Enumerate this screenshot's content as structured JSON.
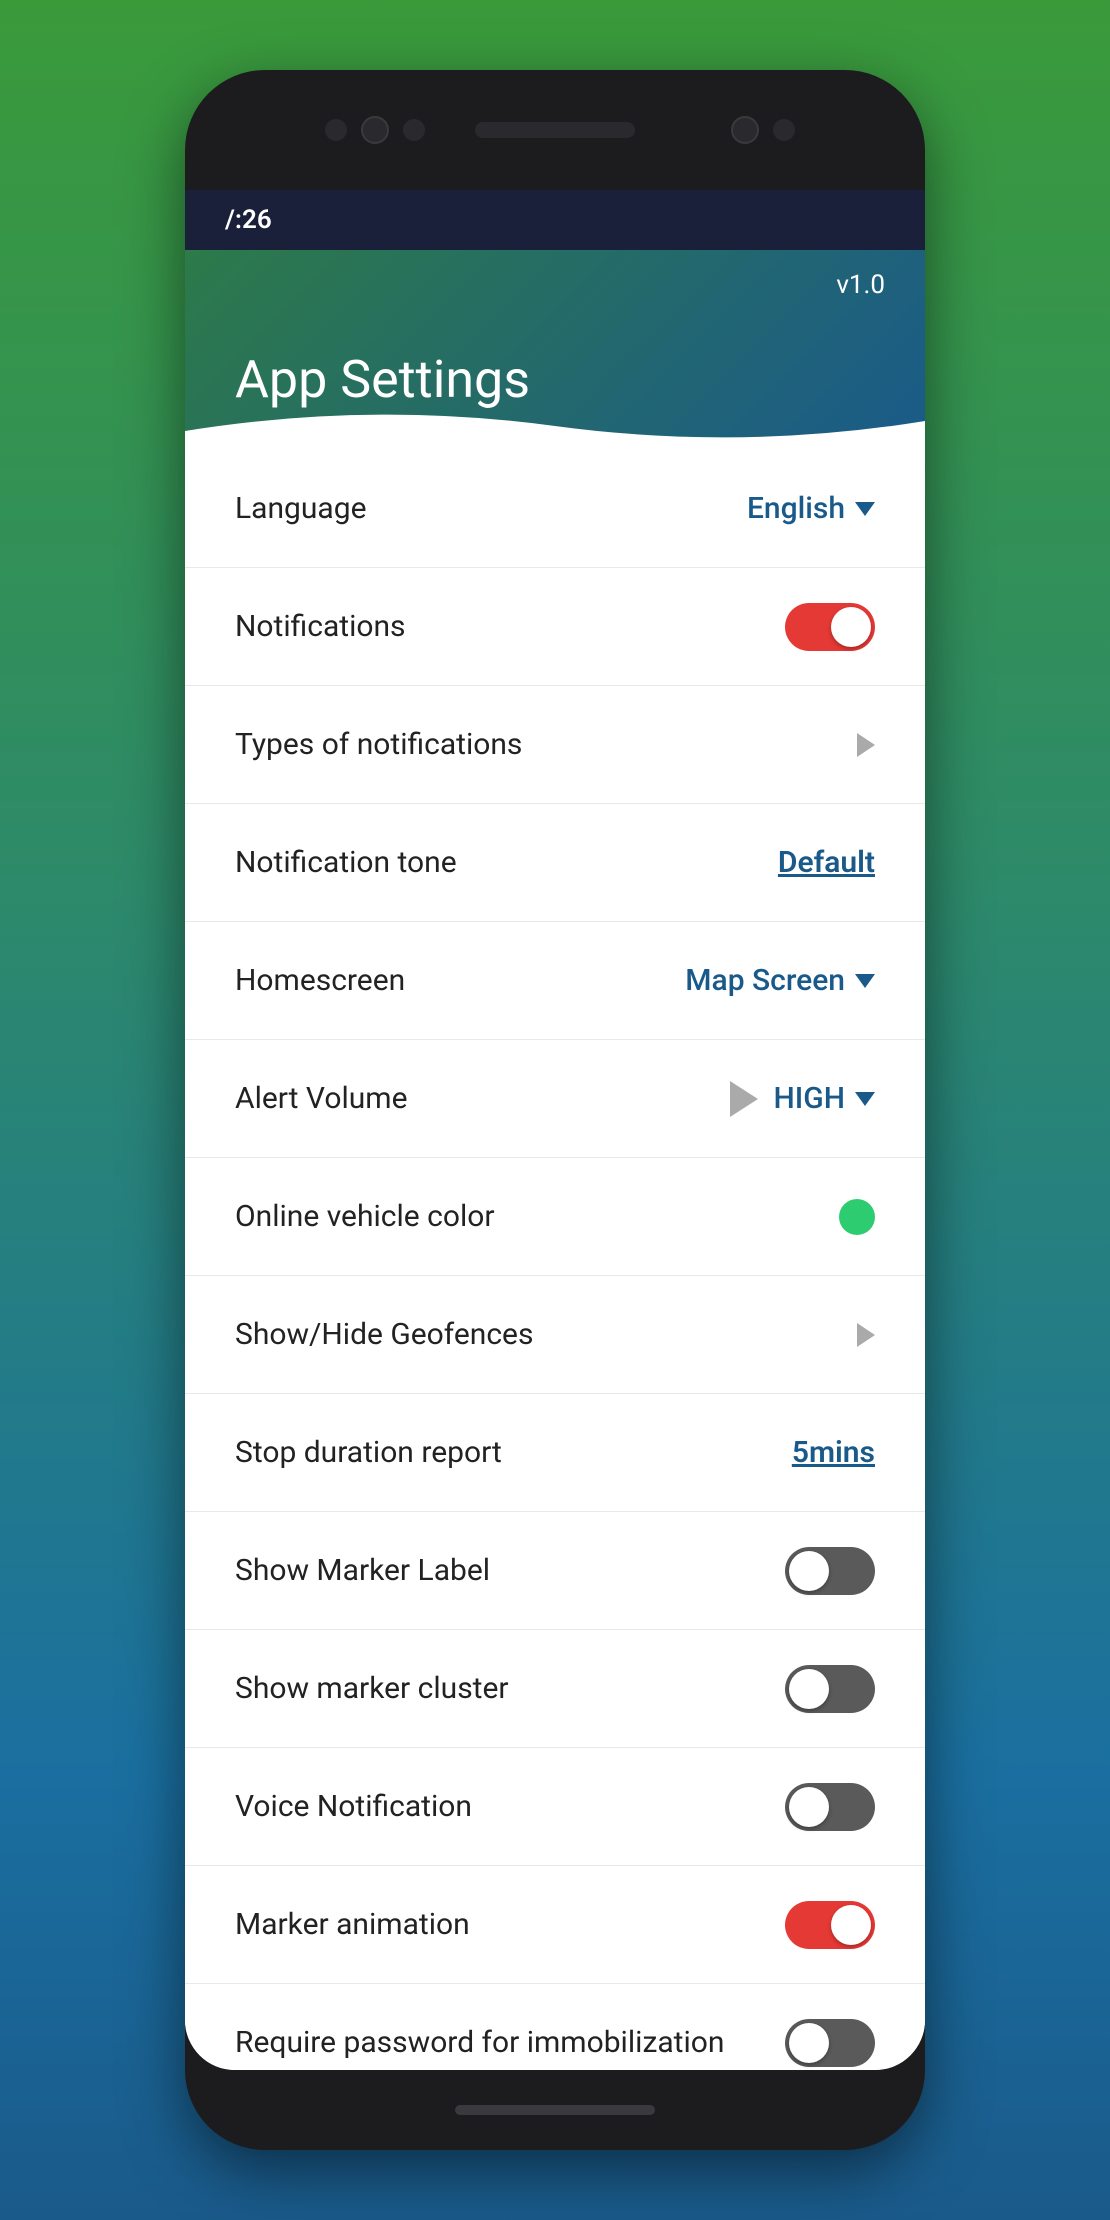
{
  "status": {
    "time": "/:26"
  },
  "header": {
    "title": "App Settings",
    "version": "v1.0"
  },
  "settings": [
    {
      "id": "language",
      "label": "Language",
      "type": "dropdown",
      "value": "English"
    },
    {
      "id": "notifications",
      "label": "Notifications",
      "type": "toggle",
      "value": true,
      "dark": false
    },
    {
      "id": "types-of-notifications",
      "label": "Types of notifications",
      "type": "chevron"
    },
    {
      "id": "notification-tone",
      "label": "Notification tone",
      "type": "link",
      "value": "Default"
    },
    {
      "id": "homescreen",
      "label": "Homescreen",
      "type": "dropdown",
      "value": "Map Screen"
    },
    {
      "id": "alert-volume",
      "label": "Alert Volume",
      "type": "play-dropdown",
      "value": "HIGH"
    },
    {
      "id": "online-vehicle-color",
      "label": "Online vehicle color",
      "type": "color",
      "value": "#2ecc71"
    },
    {
      "id": "show-hide-geofences",
      "label": "Show/Hide Geofences",
      "type": "chevron"
    },
    {
      "id": "stop-duration-report",
      "label": "Stop duration report",
      "type": "link",
      "value": "5mins"
    },
    {
      "id": "show-marker-label",
      "label": "Show Marker Label",
      "type": "toggle",
      "value": false,
      "dark": true
    },
    {
      "id": "show-marker-cluster",
      "label": "Show marker cluster",
      "type": "toggle",
      "value": false,
      "dark": true
    },
    {
      "id": "voice-notification",
      "label": "Voice Notification",
      "type": "toggle",
      "value": false,
      "dark": true
    },
    {
      "id": "marker-animation",
      "label": "Marker animation",
      "type": "toggle",
      "value": true,
      "dark": false
    },
    {
      "id": "require-password",
      "label": "Require password for immobilization",
      "type": "toggle",
      "value": false,
      "dark": true
    }
  ]
}
